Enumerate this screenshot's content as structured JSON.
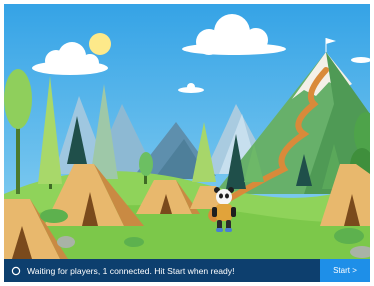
{
  "status": {
    "icon": "spinner-icon",
    "message": "Waiting for players, 1 connected. Hit Start when ready!"
  },
  "start_button": {
    "label": "Start >"
  },
  "colors": {
    "sky": "#3ba7e8",
    "grass": "#7cc84a",
    "status_bar": "#0d3f6e",
    "start_button": "#1e8fe8",
    "tent": "#e8b86d",
    "mountain_snow": "#f4f0e8"
  }
}
